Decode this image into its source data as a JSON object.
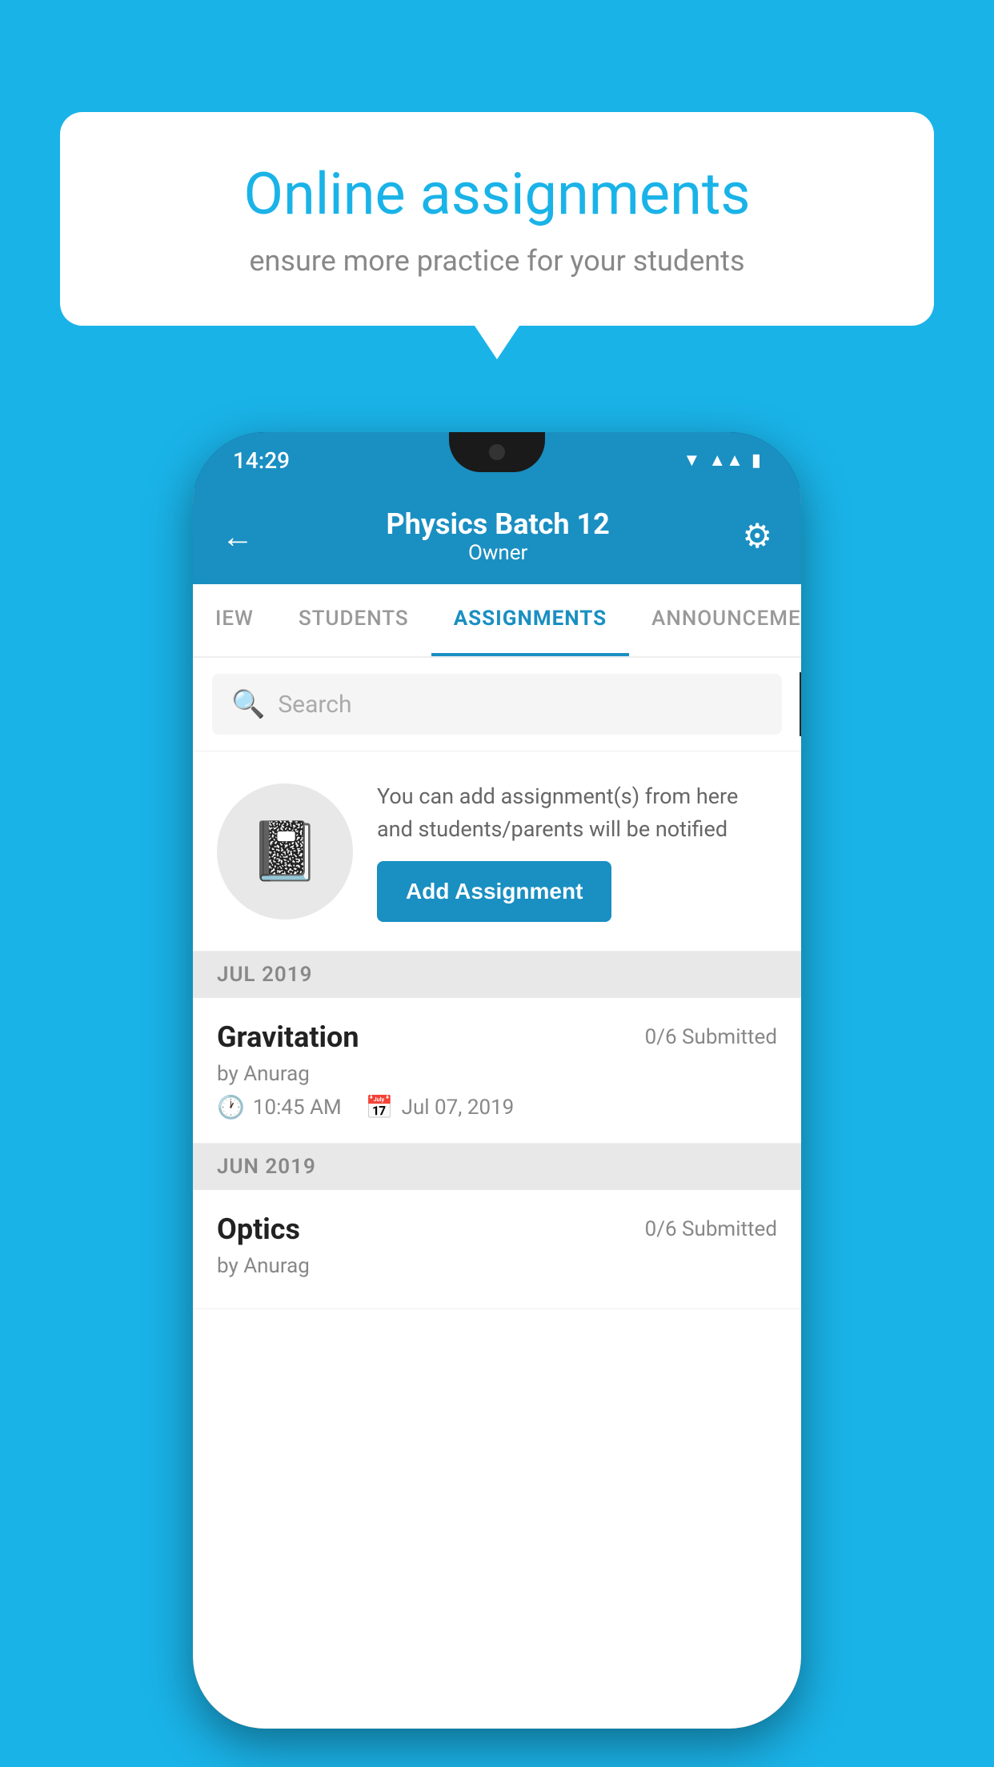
{
  "background_color": "#1ab3e8",
  "speech_bubble": {
    "title": "Online assignments",
    "subtitle": "ensure more practice for your students"
  },
  "phone": {
    "status_bar": {
      "time": "14:29",
      "icons": [
        "wifi",
        "signal",
        "battery"
      ]
    },
    "header": {
      "title": "Physics Batch 12",
      "subtitle": "Owner",
      "back_label": "←",
      "settings_label": "⚙"
    },
    "tabs": [
      {
        "label": "IEW",
        "active": false
      },
      {
        "label": "STUDENTS",
        "active": false
      },
      {
        "label": "ASSIGNMENTS",
        "active": true
      },
      {
        "label": "ANNOUNCEMENTS",
        "active": false
      }
    ],
    "search": {
      "placeholder": "Search"
    },
    "promo": {
      "description": "You can add assignment(s) from here and students/parents will be notified",
      "add_button_label": "Add Assignment"
    },
    "sections": [
      {
        "month_label": "JUL 2019",
        "assignments": [
          {
            "title": "Gravitation",
            "submitted": "0/6 Submitted",
            "author": "by Anurag",
            "time": "10:45 AM",
            "date": "Jul 07, 2019"
          }
        ]
      },
      {
        "month_label": "JUN 2019",
        "assignments": [
          {
            "title": "Optics",
            "submitted": "0/6 Submitted",
            "author": "by Anurag",
            "time": "",
            "date": ""
          }
        ]
      }
    ]
  }
}
